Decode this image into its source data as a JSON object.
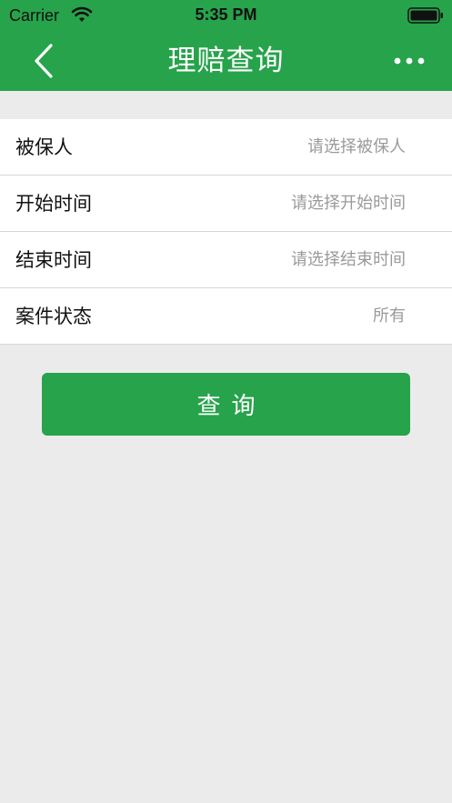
{
  "status_bar": {
    "carrier": "Carrier",
    "time": "5:35 PM"
  },
  "nav": {
    "title": "理赔查询",
    "back_icon": "chevron-left-icon",
    "more_icon": "more-horizontal-icon"
  },
  "form": {
    "rows": [
      {
        "label": "被保人",
        "value": "请选择被保人"
      },
      {
        "label": "开始时间",
        "value": "请选择开始时间"
      },
      {
        "label": "结束时间",
        "value": "请选择结束时间"
      },
      {
        "label": "案件状态",
        "value": "所有"
      }
    ]
  },
  "actions": {
    "query_label": "查询"
  },
  "colors": {
    "brand_green": "#27a34b",
    "background": "#ebebeb",
    "placeholder_gray": "#9a9a9a"
  }
}
